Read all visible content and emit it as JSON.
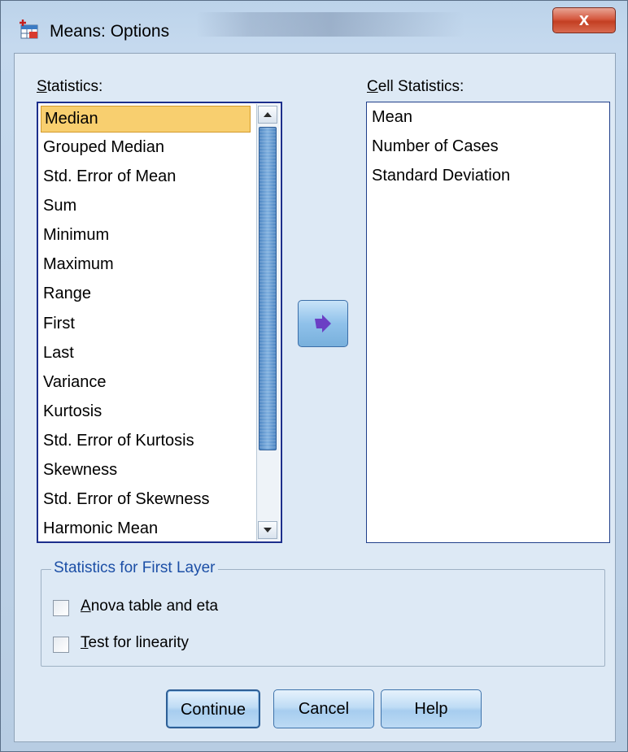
{
  "window": {
    "title": "Means: Options",
    "close_glyph": "x"
  },
  "statistics": {
    "label_underlined": "S",
    "label_rest": "tatistics:",
    "items": [
      "Median",
      "Grouped Median",
      "Std. Error of Mean",
      "Sum",
      "Minimum",
      "Maximum",
      "Range",
      "First",
      "Last",
      "Variance",
      "Kurtosis",
      "Std. Error of Kurtosis",
      "Skewness",
      "Std. Error of Skewness",
      "Harmonic Mean"
    ],
    "selected": "Median"
  },
  "cell_statistics": {
    "label_underlined": "C",
    "label_rest": "ell Statistics:",
    "items": [
      "Mean",
      "Number of Cases",
      "Standard Deviation"
    ]
  },
  "first_layer": {
    "title": "Statistics for First Layer",
    "anova_underlined": "A",
    "anova_rest": "nova table and eta",
    "anova_checked": false,
    "linearity_underlined": "T",
    "linearity_rest": "est for linearity",
    "linearity_checked": false
  },
  "buttons": {
    "continue": "Continue",
    "cancel": "Cancel",
    "help": "Help"
  },
  "colors": {
    "selection": "#f8cf6f",
    "group_title": "#1c4fa6",
    "move_arrow": "#6b3fc4"
  }
}
